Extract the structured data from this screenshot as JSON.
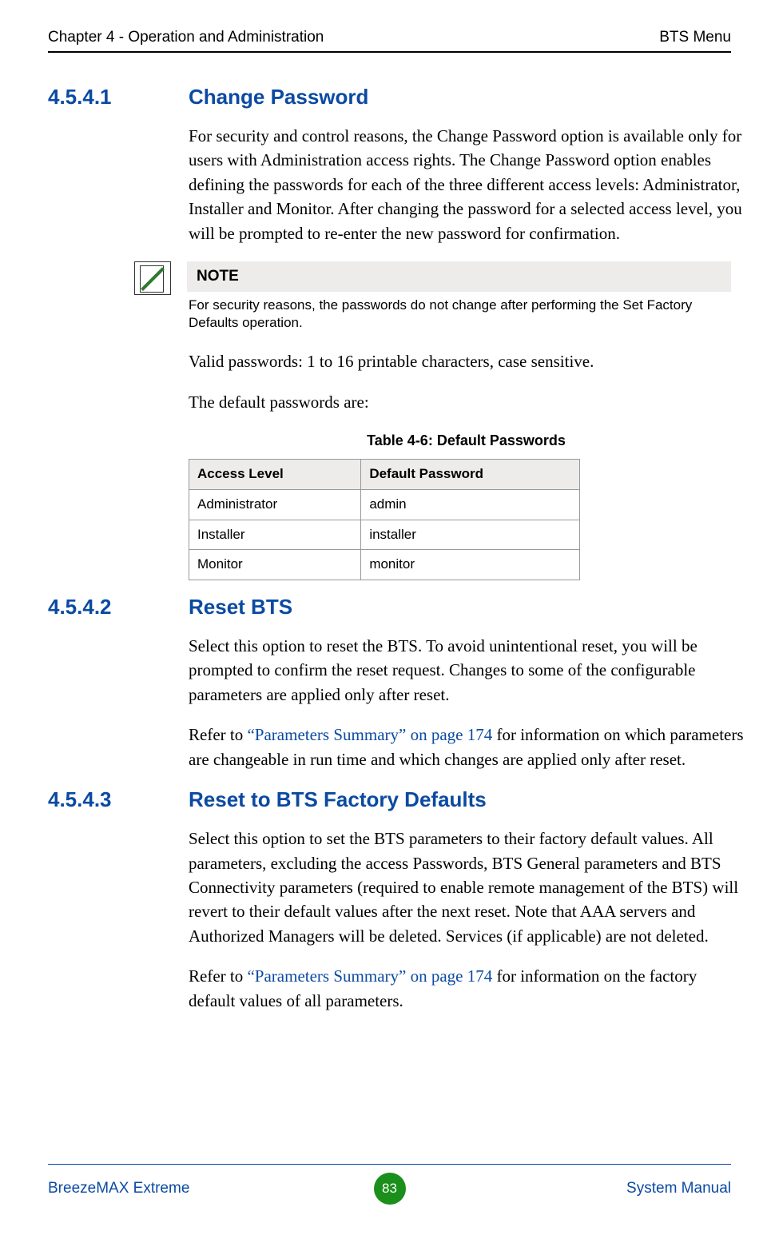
{
  "runhead": {
    "left": "Chapter 4 - Operation and Administration",
    "right": "BTS Menu"
  },
  "sections": {
    "s1": {
      "num": "4.5.4.1",
      "title": "Change Password",
      "para1": "For security and control reasons, the Change Password option is available only for users with Administration access rights. The Change Password option enables defining the passwords for each of the three different access levels: Administrator, Installer and Monitor. After changing the password for a selected access level, you will be prompted to re-enter the new password for confirmation.",
      "note_label": "NOTE",
      "note_body": "For security reasons, the passwords do not change after performing the Set Factory Defaults operation.",
      "valid_pw": "Valid passwords: 1 to 16 printable characters, case sensitive.",
      "default_intro": "The default passwords are:",
      "table": {
        "caption": "Table 4-6: Default Passwords",
        "headers": [
          "Access Level",
          "Default Password"
        ],
        "rows": [
          [
            "Administrator",
            "admin"
          ],
          [
            "Installer",
            "installer"
          ],
          [
            "Monitor",
            "monitor"
          ]
        ]
      }
    },
    "s2": {
      "num": "4.5.4.2",
      "title": "Reset BTS",
      "para1": "Select this option to reset the BTS. To avoid unintentional reset, you will be prompted to confirm the reset request. Changes to some of the configurable parameters are applied only after reset.",
      "xref_pre": "Refer to ",
      "xref": "“Parameters Summary” on page 174",
      "xref_post": " for information on which parameters are changeable in run time and which changes are applied only after reset."
    },
    "s3": {
      "num": "4.5.4.3",
      "title": "Reset to BTS Factory Defaults",
      "para1": "Select this option to set the BTS parameters to their factory default values. All parameters, excluding the access Passwords, BTS General parameters and BTS Connectivity parameters (required to enable remote management of the BTS) will revert to their default values after the next reset. Note that AAA servers and Authorized Managers will be deleted. Services (if applicable) are not deleted.",
      "xref_pre": "Refer to ",
      "xref": "“Parameters Summary” on page 174",
      "xref_post": " for information on the factory default values of all parameters."
    }
  },
  "footer": {
    "left": "BreezeMAX Extreme",
    "page": "83",
    "right": "System Manual"
  }
}
